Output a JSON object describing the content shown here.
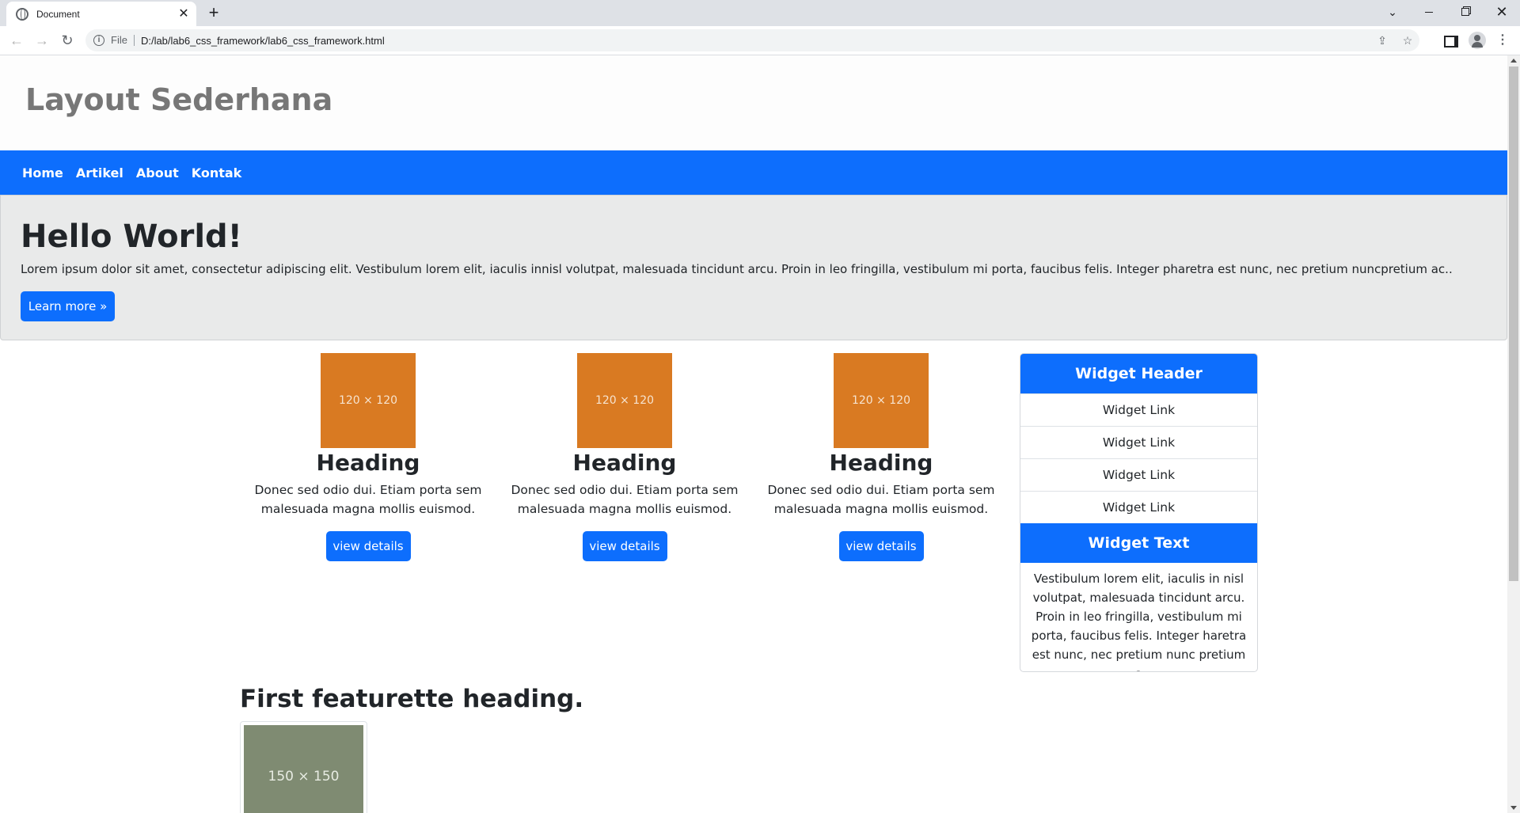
{
  "browser": {
    "tab_title": "Document",
    "tab_close": "✕",
    "new_tab": "+",
    "url_scheme": "File",
    "url": "D:/lab/lab6_css_framework/lab6_css_framework.html"
  },
  "site": {
    "title": "Layout Sederhana",
    "nav": [
      "Home",
      "Artikel",
      "About",
      "Kontak"
    ]
  },
  "hero": {
    "title": "Hello World!",
    "text": "Lorem ipsum dolor sit amet, consectetur adipiscing elit. Vestibulum lorem elit, iaculis innisl volutpat, malesuada tincidunt arcu. Proin in leo fringilla, vestibulum mi porta, faucibus felis. Integer pharetra est nunc, nec pretium nuncpretium ac..",
    "button": "Learn more »"
  },
  "cards": [
    {
      "thumb": "120 × 120",
      "heading": "Heading",
      "text": "Donec sed odio dui. Etiam porta sem malesuada magna mollis euismod.",
      "button": "view details"
    },
    {
      "thumb": "120 × 120",
      "heading": "Heading",
      "text": "Donec sed odio dui. Etiam porta sem malesuada magna mollis euismod.",
      "button": "view details"
    },
    {
      "thumb": "120 × 120",
      "heading": "Heading",
      "text": "Donec sed odio dui. Etiam porta sem malesuada magna mollis euismod.",
      "button": "view details"
    }
  ],
  "widget": {
    "header": "Widget Header",
    "links": [
      "Widget Link",
      "Widget Link",
      "Widget Link",
      "Widget Link"
    ],
    "text_header": "Widget Text",
    "text": "Vestibulum lorem elit, iaculis in nisl volutpat, malesuada tincidunt arcu. Proin in leo fringilla, vestibulum mi porta, faucibus felis. Integer haretra est nunc, nec pretium nunc pretium a"
  },
  "featurette": {
    "heading": "First featurette heading.",
    "image": "150 × 150"
  },
  "colors": {
    "primary": "#0d6efd",
    "thumb_orange": "#d97a22",
    "featurette_gray": "#7f8b72"
  }
}
